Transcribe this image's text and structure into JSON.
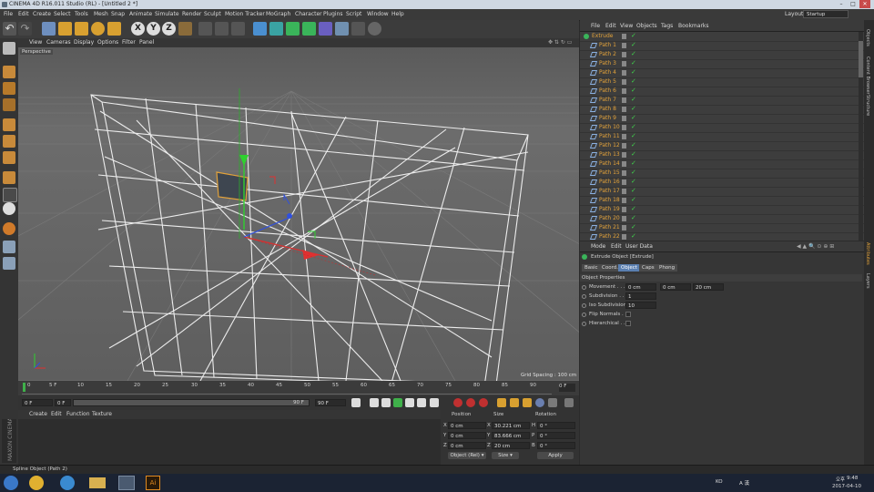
{
  "window": {
    "title": "CINEMA 4D R16.011 Studio (RL) - [Untitled 2 *]",
    "minimize": "–",
    "maximize": "□",
    "close": "✕"
  },
  "menu": [
    "File",
    "Edit",
    "Create",
    "Select",
    "Tools",
    "Mesh",
    "Snap",
    "Animate",
    "Simulate",
    "Render",
    "Sculpt",
    "Motion Tracker",
    "MoGraph",
    "Character",
    "Plugins",
    "Script",
    "Window",
    "Help"
  ],
  "layout": {
    "label": "Layout:",
    "value": "Startup"
  },
  "toolbar": {
    "undo_icon": "undo-icon",
    "xyz": [
      "X",
      "Y",
      "Z"
    ]
  },
  "viewport": {
    "menu": [
      "View",
      "Cameras",
      "Display",
      "Options",
      "Filter",
      "Panel"
    ],
    "camera_label": "Perspective",
    "grid_spacing": "Grid Spacing : 100 cm"
  },
  "timeline": {
    "ticks": [
      "0",
      "5 F",
      "10",
      "15",
      "20",
      "25",
      "30",
      "35",
      "40",
      "45",
      "50",
      "55",
      "60",
      "65",
      "70",
      "75",
      "80",
      "85",
      "90"
    ],
    "end_label": "0 F"
  },
  "transport": {
    "current": "0 F",
    "start": "0 F",
    "range_end": "90 F",
    "end": "90 F"
  },
  "material_panel": {
    "menu": [
      "Create",
      "Edit",
      "Function",
      "Texture"
    ]
  },
  "coord_panel": {
    "headers": [
      "Position",
      "Size",
      "Rotation"
    ],
    "rows": [
      {
        "axis": "X",
        "pos": "0 cm",
        "size_axis": "X",
        "size": "30.221 cm",
        "rot_axis": "H",
        "rot": "0 °"
      },
      {
        "axis": "Y",
        "pos": "0 cm",
        "size_axis": "Y",
        "size": "83.666 cm",
        "rot_axis": "P",
        "rot": "0 °"
      },
      {
        "axis": "Z",
        "pos": "0 cm",
        "size_axis": "Z",
        "size": "20 cm",
        "rot_axis": "B",
        "rot": "0 °"
      }
    ],
    "mode": "Object (Rel) ▾",
    "size_mode": "Size ▾",
    "apply": "Apply"
  },
  "object_manager": {
    "menu": [
      "File",
      "Edit",
      "View",
      "Objects",
      "Tags",
      "Bookmarks"
    ],
    "root": "Extrude",
    "paths": [
      "Path 1",
      "Path 2",
      "Path 3",
      "Path 4",
      "Path 5",
      "Path 6",
      "Path 7",
      "Path 8",
      "Path 9",
      "Path 10",
      "Path 11",
      "Path 12",
      "Path 13",
      "Path 14",
      "Path 15",
      "Path 16",
      "Path 17",
      "Path 18",
      "Path 19",
      "Path 20",
      "Path 21",
      "Path 22"
    ]
  },
  "attribute_manager": {
    "menu": [
      "Mode",
      "Edit",
      "User Data"
    ],
    "object_title": "Extrude Object [Extrude]",
    "tabs": [
      "Basic",
      "Coord.",
      "Object",
      "Caps",
      "Phong"
    ],
    "active_tab": "Object",
    "section": "Object Properties",
    "movement_label": "Movement . . . .",
    "movement": [
      "0 cm",
      "0 cm",
      "20 cm"
    ],
    "subdivision_label": "Subdivision . . .",
    "subdivision": "1",
    "iso_label": "Iso Subdivision",
    "iso": "10",
    "flip_label": "Flip Normals . .",
    "hier_label": "Hierarchical . ."
  },
  "right_tabs": [
    "Objects",
    "Content Browser",
    "Structure",
    "Attributes",
    "Layers"
  ],
  "status": "Spline Object (Path 2)",
  "taskbar": {
    "lang": "KO",
    "tray": "A 漢",
    "ampm": "오후",
    "time": "9:48",
    "date": "2017-04-10"
  },
  "colors": {
    "accent_orange": "#e2a23a",
    "tab_active": "#5a7fb0",
    "play_green": "#3fb04a",
    "record_red": "#c03030"
  }
}
